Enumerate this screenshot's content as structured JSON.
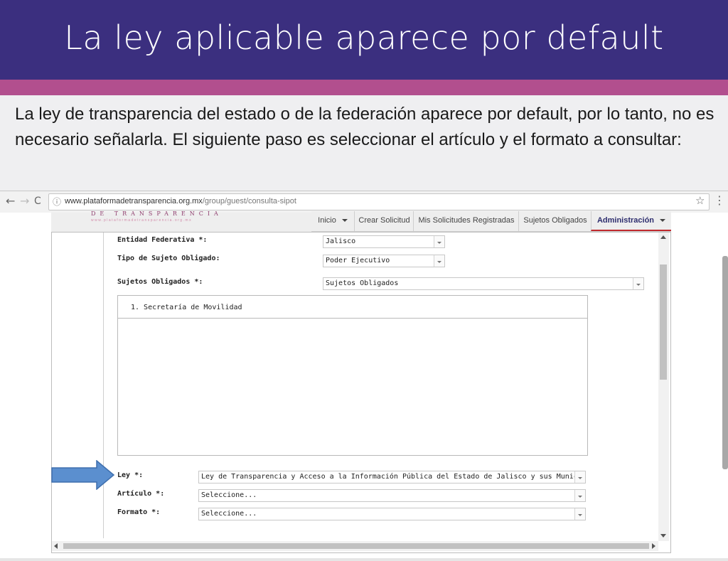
{
  "slide": {
    "title": "La ley aplicable aparece por default",
    "body": "La ley de transparencia del estado o de la federación aparece por default, por lo tanto, no es necesario señalarla. El siguiente paso es seleccionar el artículo y el formato a consultar:"
  },
  "browser": {
    "url_host": "www.plataformadetransparencia.org.mx",
    "url_path": "/group/guest/consulta-sipot",
    "back_icon": "←",
    "forward_icon": "→",
    "reload_icon": "C",
    "info_icon": "ⓘ",
    "star_icon": "☆",
    "menu_icon": "⋮"
  },
  "site": {
    "logo_text": "DE TRANSPARENCIA",
    "logo_sub": "www.plataformadetransparencia.org.mx",
    "nav": [
      {
        "label": "Inicio",
        "dropdown": true
      },
      {
        "label": "Crear Solicitud",
        "dropdown": false
      },
      {
        "label": "Mis Solicitudes Registradas",
        "dropdown": false
      },
      {
        "label": "Sujetos Obligados",
        "dropdown": false
      },
      {
        "label": "Administración",
        "dropdown": true,
        "active": true
      }
    ]
  },
  "form": {
    "entidad_label": "Entidad Federativa *:",
    "entidad_value": "Jalisco",
    "tipo_label": "Tipo de Sujeto Obligado:",
    "tipo_value": "Poder Ejecutivo",
    "sujetos_label": "Sujetos Obligados *:",
    "sujetos_value": "Sujetos Obligados",
    "sujetos_list": [
      "1. Secretaría de Movilidad"
    ],
    "ley_label": "Ley *:",
    "ley_value": "Ley de Transparencia y Acceso a la Información Pública del Estado de Jalisco y sus Municipios",
    "articulo_label": "Artículo *:",
    "articulo_value": "Seleccione...",
    "formato_label": "Formato *:",
    "formato_value": "Seleccione..."
  },
  "colors": {
    "title_bar": "#3b2f7f",
    "accent_bar": "#b24f8e",
    "arrow_fill": "#5b8fcf",
    "nav_active_underline": "#c0282d"
  }
}
